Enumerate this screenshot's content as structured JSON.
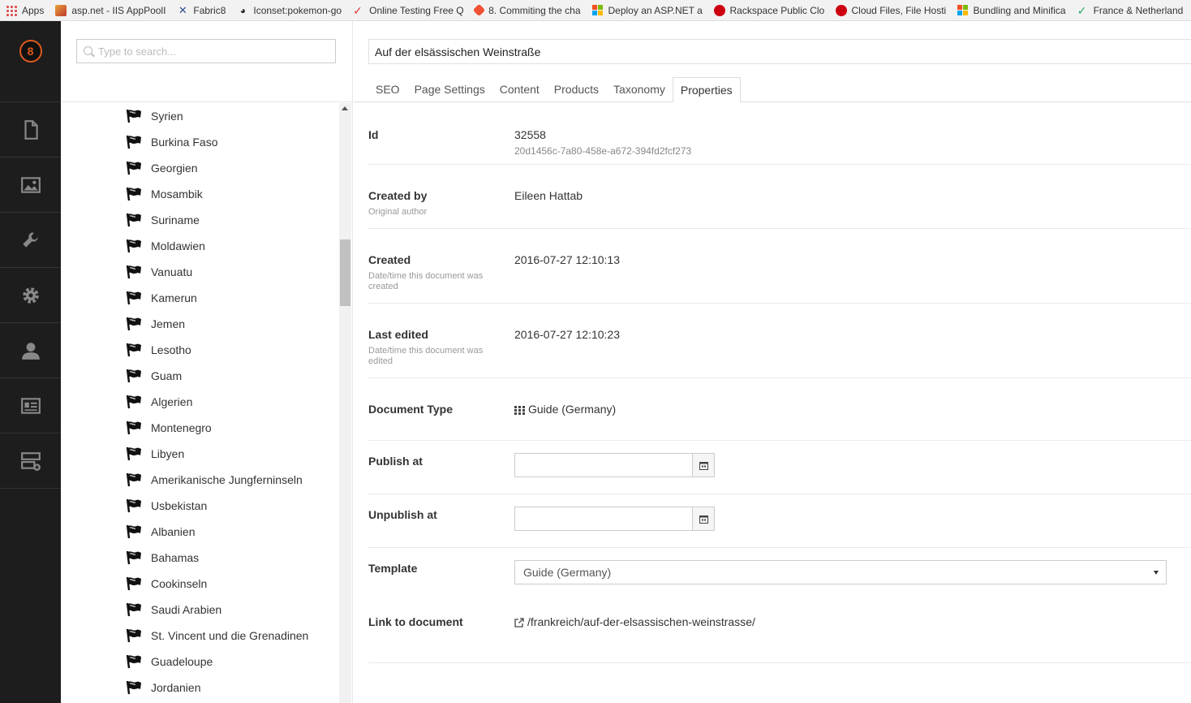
{
  "bookmarks": [
    {
      "label": "Apps",
      "icon": "apps-icon"
    },
    {
      "label": "asp.net - IIS AppPoolI",
      "icon": "iis-icon"
    },
    {
      "label": "Fabric8",
      "icon": "fabric8-icon"
    },
    {
      "label": "Iconset:pokemon-go",
      "icon": "pokemon-icon"
    },
    {
      "label": "Online Testing Free Q",
      "icon": "checkmark-icon"
    },
    {
      "label": "8. Commiting the cha",
      "icon": "git-icon"
    },
    {
      "label": "Deploy an ASP.NET ap",
      "icon": "microsoft-icon"
    },
    {
      "label": "Rackspace Public Clou",
      "icon": "rackspace-icon"
    },
    {
      "label": "Cloud Files, File Hosti",
      "icon": "rackspace-icon"
    },
    {
      "label": "Bundling and Minifica",
      "icon": "microsoft-icon"
    },
    {
      "label": "France & Netherland",
      "icon": "tick-icon"
    }
  ],
  "app": {
    "logo_text": "8",
    "nav": [
      {
        "name": "content",
        "icon": "document-icon"
      },
      {
        "name": "media",
        "icon": "image-icon"
      },
      {
        "name": "settings",
        "icon": "wrench-icon"
      },
      {
        "name": "developer",
        "icon": "gear-icon"
      },
      {
        "name": "users",
        "icon": "user-icon"
      },
      {
        "name": "members",
        "icon": "id-card-icon"
      },
      {
        "name": "forms",
        "icon": "server-add-icon"
      }
    ]
  },
  "tree": {
    "search_placeholder": "Type to search...",
    "items": [
      "Syrien",
      "Burkina Faso",
      "Georgien",
      "Mosambik",
      "Suriname",
      "Moldawien",
      "Vanuatu",
      "Kamerun",
      "Jemen",
      "Lesotho",
      "Guam",
      "Algerien",
      "Montenegro",
      "Libyen",
      "Amerikanische Jungferninseln",
      "Usbekistan",
      "Albanien",
      "Bahamas",
      "Cookinseln",
      "Saudi Arabien",
      "St. Vincent und die Grenadinen",
      "Guadeloupe",
      "Jordanien"
    ]
  },
  "editor": {
    "document_name": "Auf der elsässischen Weinstraße",
    "tabs": [
      "SEO",
      "Page Settings",
      "Content",
      "Products",
      "Taxonomy",
      "Properties"
    ],
    "active_tab": "Properties",
    "properties": {
      "id": {
        "label": "Id",
        "value": "32558",
        "guid": "20d1456c-7a80-458e-a672-394fd2fcf273"
      },
      "created_by": {
        "label": "Created by",
        "description": "Original author",
        "value": "Eileen Hattab"
      },
      "created": {
        "label": "Created",
        "description": "Date/time this document was created",
        "value": "2016-07-27 12:10:13"
      },
      "last_edited": {
        "label": "Last edited",
        "description": "Date/time this document was edited",
        "value": "2016-07-27 12:10:23"
      },
      "document_type": {
        "label": "Document Type",
        "value": "Guide (Germany)"
      },
      "publish_at": {
        "label": "Publish at",
        "value": ""
      },
      "unpublish_at": {
        "label": "Unpublish at",
        "value": ""
      },
      "template": {
        "label": "Template",
        "value": "Guide (Germany)"
      },
      "link": {
        "label": "Link to document",
        "value": "/frankreich/auf-der-elsassischen-weinstrasse/"
      }
    }
  }
}
